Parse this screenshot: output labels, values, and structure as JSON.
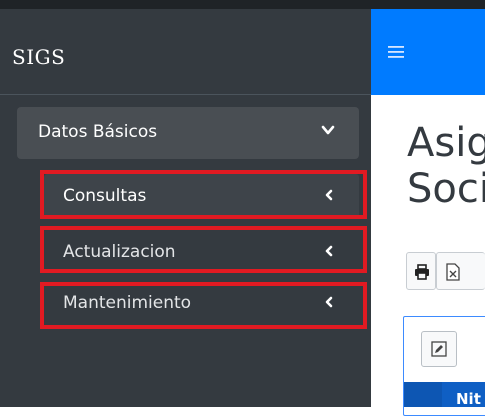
{
  "app": {
    "brand": "SIGS"
  },
  "sidebar": {
    "menu_open": {
      "label": "Datos Básicos",
      "icon": "chevron-down-icon"
    },
    "items": [
      {
        "label": "Consultas",
        "icon": "chevron-left-icon",
        "active": true
      },
      {
        "label": "Actualizacion",
        "icon": "chevron-left-icon",
        "active": false
      },
      {
        "label": "Mantenimiento",
        "icon": "chevron-left-icon",
        "active": false
      }
    ]
  },
  "navbar": {
    "menu_icon": "hamburger-icon"
  },
  "main": {
    "title_line1": "Asig",
    "title_line2": "Soci",
    "toolbar": {
      "buttons": [
        "print-icon",
        "excel-icon"
      ]
    },
    "table": {
      "edit_icon": "pencil-icon",
      "columns": [
        "",
        "Nit"
      ]
    }
  },
  "colors": {
    "sidebar_bg": "#343a40",
    "navbar_bg": "#007bff",
    "highlight": "#e11a22",
    "table_header": "#0f5fc4"
  }
}
